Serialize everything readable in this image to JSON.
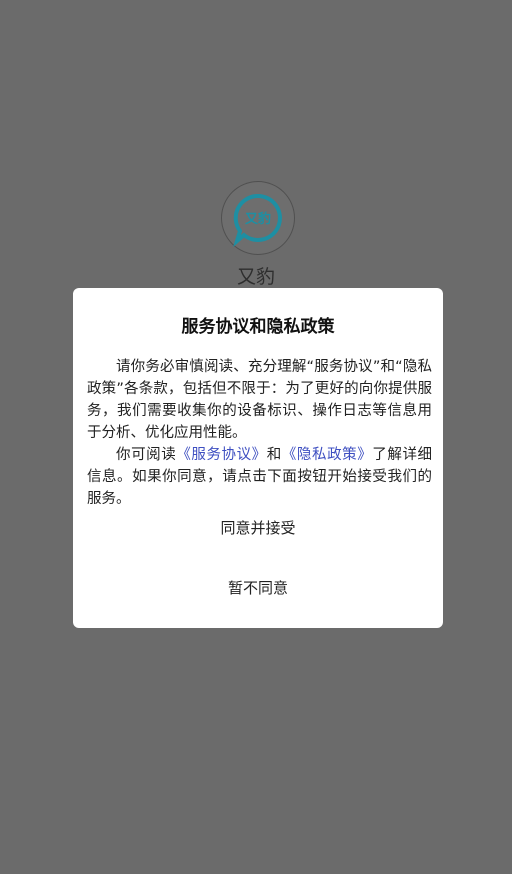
{
  "app": {
    "name": "又豹",
    "logo_text": "又豹",
    "logo_icon": "speech-bubble-logo"
  },
  "dialog": {
    "title": "服务协议和隐私政策",
    "paragraph1": "请你务必审慎阅读、充分理解“服务协议”和“隐私政策”各条款，包括但不限于：为了更好的向你提供服务，我们需要收集你的设备标识、操作日志等信息用于分析、优化应用性能。",
    "p2_prefix": "你可阅读",
    "service_link": "《服务协议》",
    "p2_and": "和",
    "privacy_link": "《隐私政策》",
    "p2_suffix": "了解详细信息。如果你同意，请点击下面按钮开始接受我们的服务。",
    "agree_label": "同意并接受",
    "disagree_label": "暂不同意"
  },
  "colors": {
    "overlay": "#6b6b6b",
    "link": "#3e4fc1",
    "logo_ring": "#1e8fa3"
  }
}
